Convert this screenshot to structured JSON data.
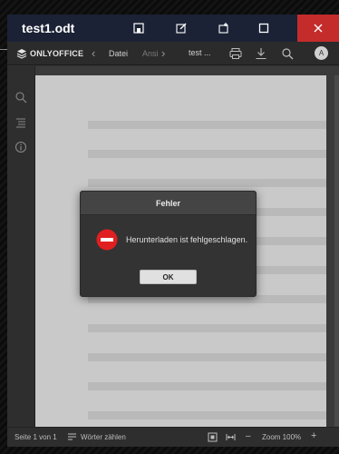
{
  "window": {
    "title": "test1.odt"
  },
  "toolbar": {
    "brand": "ONLYOFFICE",
    "menu_items": [
      "Datei",
      "Ansi"
    ],
    "document_name": "test ...",
    "avatar_initial": "A"
  },
  "dialog": {
    "title": "Fehler",
    "message": "Herunterladen ist fehlgeschlagen.",
    "ok_label": "OK"
  },
  "statusbar": {
    "page_info": "Seite 1 von 1",
    "word_count_label": "Wörter zählen",
    "zoom_label": "Zoom 100%",
    "zoom_out": "–",
    "zoom_in": "+"
  },
  "colors": {
    "titlebar_bg": "#1b2235",
    "close_button": "#c42b2b",
    "error_icon": "#e02020",
    "page_bg": "#c9c9c9"
  },
  "icons": {
    "titlebar": [
      "open-file-location-icon",
      "edit-icon",
      "new-window-icon",
      "maximize-icon",
      "close-icon"
    ],
    "toolbar": [
      "onlyoffice-logo-icon",
      "chevron-left-icon",
      "chevron-right-icon",
      "print-icon",
      "download-icon",
      "search-icon"
    ],
    "sidebar": [
      "search-icon",
      "navigation-icon",
      "info-icon"
    ],
    "statusbar": [
      "word-count-icon",
      "fit-page-icon",
      "fit-width-icon"
    ],
    "dialog": "error-icon"
  }
}
